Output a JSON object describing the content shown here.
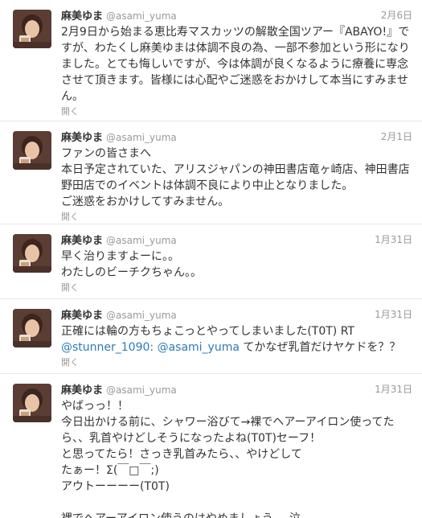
{
  "tweets": [
    {
      "name": "麻美ゆま",
      "handle": "@asami_yuma",
      "date": "2月6日",
      "lines": [
        "2月9日から始まる恵比寿マスカッツの解散全国ツアー『ABAYO!』で",
        "すが、わたくし麻美ゆまは体調不良の為、一部不参加という形になり",
        "ました。とても悔しいですが、今は体調が良くなるように療養に専念",
        "させて頂きます。皆様には心配やご迷惑をおかけして本当にすみませ",
        "ん。"
      ],
      "expand": "開く"
    },
    {
      "name": "麻美ゆま",
      "handle": "@asami_yuma",
      "date": "2月1日",
      "lines": [
        "ファンの皆さまへ",
        "本日予定されていた、アリスジャパンの神田書店竜ヶ崎店、神田書店",
        "野田店でのイベントは体調不良により中止となりました。",
        "ご迷惑をおかけしてすみません。"
      ],
      "expand": "開く"
    },
    {
      "name": "麻美ゆま",
      "handle": "@asami_yuma",
      "date": "1月31日",
      "lines": [
        "早く治りますよーに。。",
        "わたしのビーチクちゃん。。"
      ],
      "expand": "開く"
    },
    {
      "name": "麻美ゆま",
      "handle": "@asami_yuma",
      "date": "1月31日",
      "line1": "正確には輪の方もちょこっとやってしまいました(T0T) RT",
      "mention1": "@stunner_1090:",
      "mention2": "@asami_yuma",
      "line2_rest": "てかなぜ乳首だけヤケドを？？",
      "expand": "開く"
    },
    {
      "name": "麻美ゆま",
      "handle": "@asami_yuma",
      "date": "1月31日",
      "lines": [
        "やばっっ！！",
        "今日出かける前に、シャワー浴びて→裸でヘアーアイロン使ってた",
        "ら、、乳首やけどしそうになったよね(T0T)セーフ！",
        "と思ってたら！さっき乳首みたら、、やけどして",
        "たぁー！Σ(￣□￣;)",
        "アウトーーーー(T0T)"
      ],
      "last_line": "裸でヘアーアイロン使うのはやめましょう。。泣"
    }
  ],
  "colors": {
    "mention": "#2b7bb9",
    "meta": "#999999",
    "text": "#333333",
    "divider": "#e8e8e8"
  }
}
